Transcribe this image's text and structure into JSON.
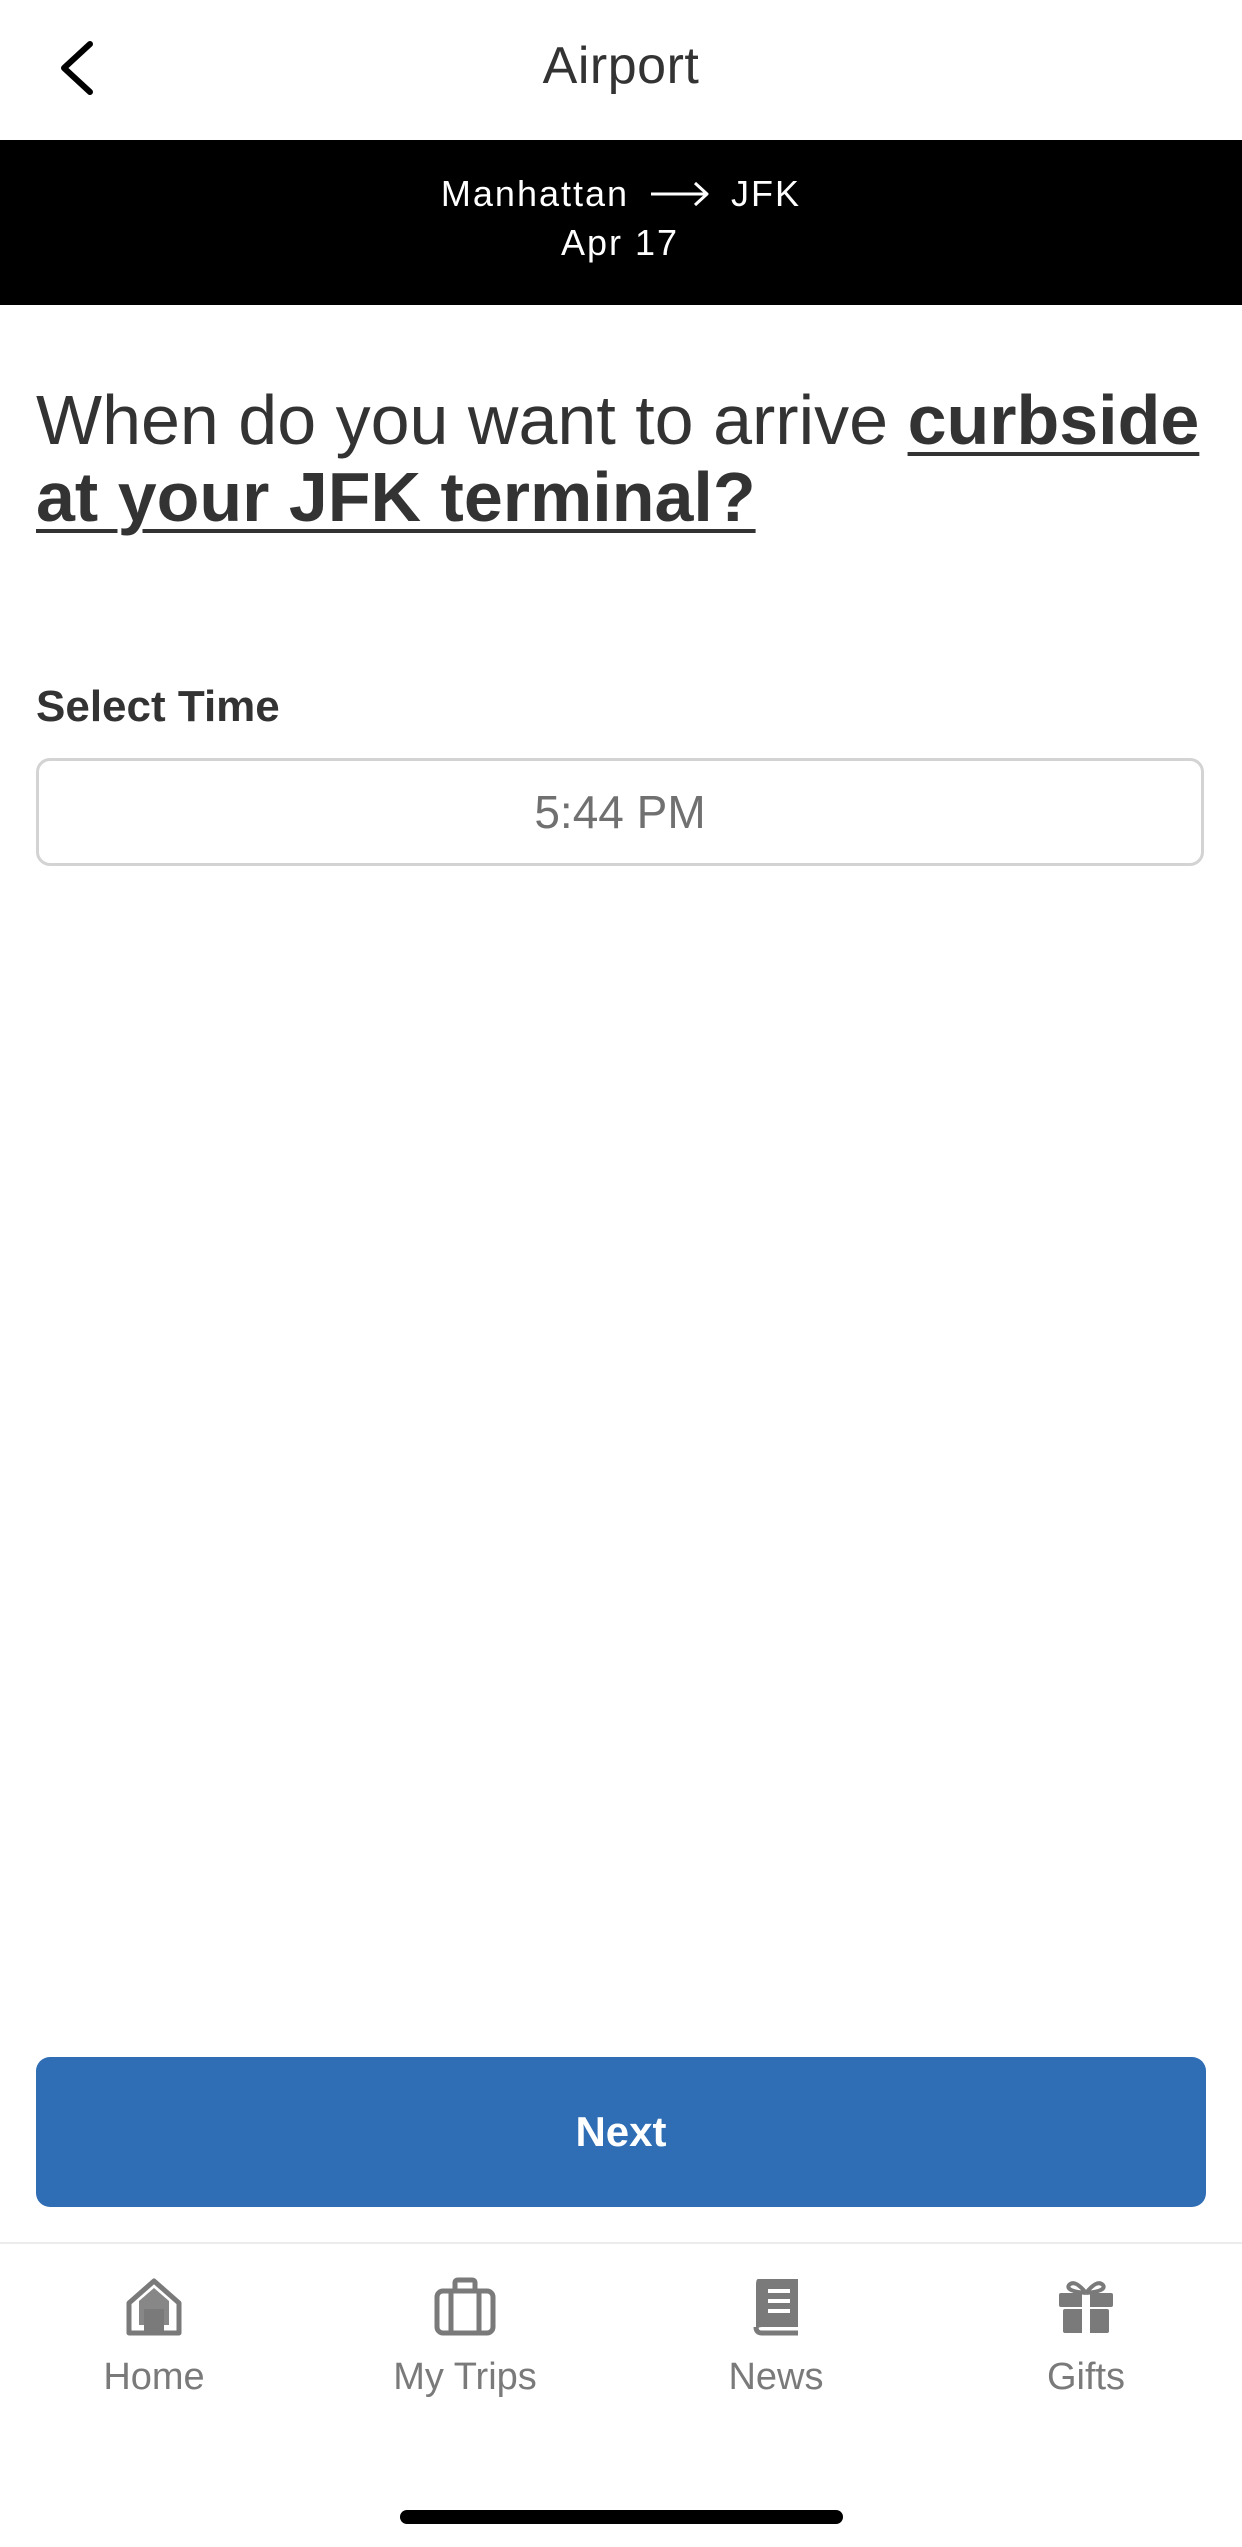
{
  "header": {
    "title": "Airport"
  },
  "route": {
    "origin": "Manhattan",
    "destination": "JFK",
    "date": "Apr 17"
  },
  "question": {
    "prefix": "When do you want to arrive ",
    "emphasis": "curbside at your JFK terminal?"
  },
  "time_selector": {
    "label": "Select Time",
    "value": "5:44 PM"
  },
  "actions": {
    "next_label": "Next"
  },
  "tabbar": {
    "items": [
      {
        "label": "Home",
        "icon": "home-icon"
      },
      {
        "label": "My Trips",
        "icon": "briefcase-icon"
      },
      {
        "label": "News",
        "icon": "newspaper-icon"
      },
      {
        "label": "Gifts",
        "icon": "gift-icon"
      }
    ]
  },
  "colors": {
    "primary": "#2f6db5",
    "banner": "#000000",
    "text": "#333333",
    "muted": "#7a7a7a"
  }
}
